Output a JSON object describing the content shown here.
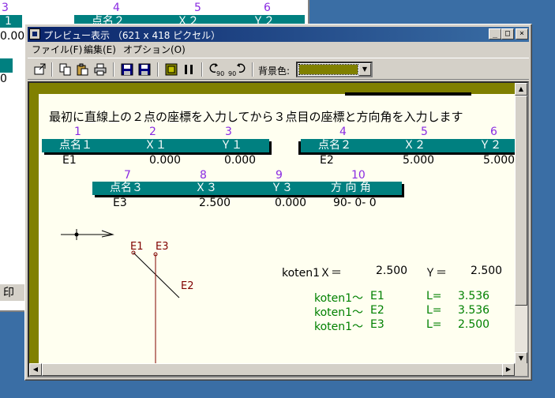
{
  "background_window": {
    "col_numbers": [
      "3",
      "4",
      "5",
      "6"
    ],
    "header_cells": [
      "1",
      "点名２",
      "Ｘ２",
      "Ｙ２"
    ],
    "values": [
      "0.00",
      "0"
    ],
    "status": "印"
  },
  "window": {
    "title": "プレビュー表示 （621 x 418 ピクセル）",
    "caption_buttons": {
      "minimize": "_",
      "maximize": "□",
      "close": "×"
    }
  },
  "menu": [
    {
      "label": "ファイル(F)"
    },
    {
      "label": "編集(E)"
    },
    {
      "label": "オプション(O)"
    }
  ],
  "toolbar": {
    "rotate_left_label": "90",
    "rotate_right_label": "90",
    "bg_color_label": "背景色:",
    "bg_color_value": "#808000"
  },
  "preview": {
    "instruction": "最初に直線上の２点の座標を入力してから３点目の座標と方向角を入力します",
    "col_numbers": [
      "1",
      "2",
      "3",
      "4",
      "5",
      "6",
      "7",
      "8",
      "9",
      "10"
    ],
    "table1": {
      "headers": [
        "点名１",
        "Ｘ１",
        "Ｙ１"
      ],
      "values": [
        "E1",
        "0.000",
        "0.000"
      ]
    },
    "table2": {
      "headers": [
        "点名２",
        "Ｘ２",
        "Ｙ２"
      ],
      "values": [
        "E2",
        "5.000",
        "5.000"
      ]
    },
    "table3": {
      "headers": [
        "点名３",
        "Ｘ３",
        "Ｙ３",
        "方 向 角"
      ],
      "values": [
        "E3",
        "2.500",
        "0.000",
        "90- 0- 0"
      ]
    },
    "diagram_labels": {
      "e1": "E1",
      "e3": "E3",
      "e2": "E2"
    },
    "result": {
      "label": "koten1Ｘ＝",
      "x": "2.500",
      "y_label": "Ｙ＝",
      "y": "2.500"
    },
    "distances": [
      {
        "from": "koten1～",
        "to": "E1",
        "l": "L=",
        "value": "3.536"
      },
      {
        "from": "koten1～",
        "to": "E2",
        "l": "L=",
        "value": "3.536"
      },
      {
        "from": "koten1～",
        "to": "E3",
        "l": "L=",
        "value": "2.500"
      }
    ]
  }
}
